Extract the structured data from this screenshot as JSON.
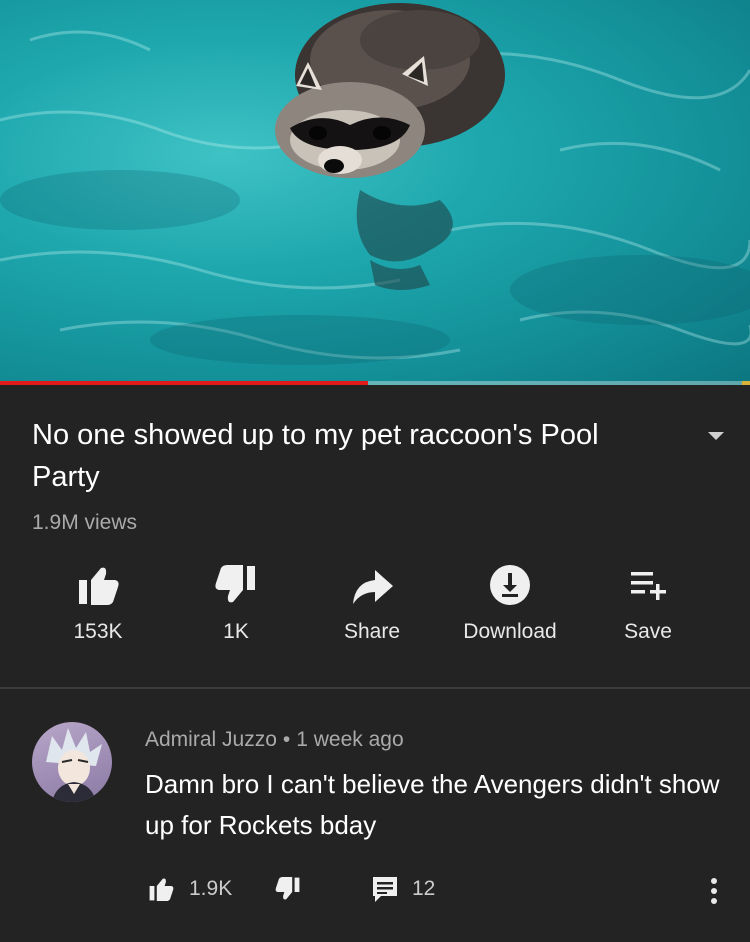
{
  "video": {
    "progress_fraction": 0.49,
    "colors": {
      "progress": "#e21a1a",
      "water": "#1ea8ae"
    }
  },
  "details": {
    "title": "No one showed up to my pet raccoon's Pool Party",
    "views": "1.9M views",
    "expand_icon": "chevron-down-icon"
  },
  "actions": {
    "like": {
      "label": "153K",
      "icon": "thumbs-up-icon"
    },
    "dislike": {
      "label": "1K",
      "icon": "thumbs-down-icon"
    },
    "share": {
      "label": "Share",
      "icon": "share-arrow-icon"
    },
    "download": {
      "label": "Download",
      "icon": "download-icon"
    },
    "save": {
      "label": "Save",
      "icon": "playlist-add-icon"
    }
  },
  "comment": {
    "author": "Admiral Juzzo",
    "separator": "•",
    "time": "1 week ago",
    "text": "Damn bro I can't believe the Avengers didn't show up for Rockets bday",
    "likes": "1.9K",
    "replies": "12",
    "more_icon": "more-vertical-icon"
  }
}
